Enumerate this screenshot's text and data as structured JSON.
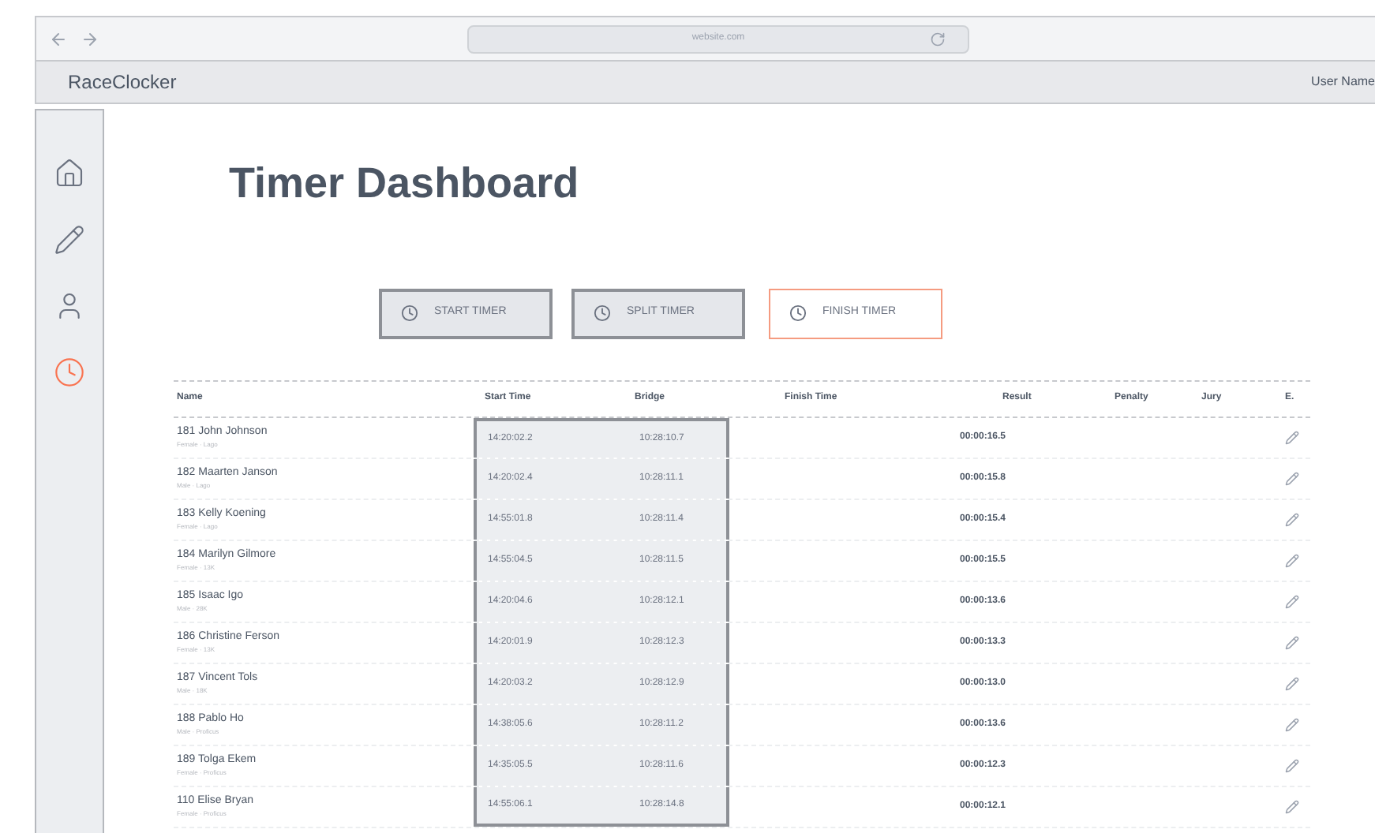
{
  "browser": {
    "url": "website.com"
  },
  "app": {
    "name": "RaceClocker",
    "user": "User Name"
  },
  "sidebar": {
    "items": [
      {
        "kind": "home",
        "selected": false
      },
      {
        "kind": "edit",
        "selected": false
      },
      {
        "kind": "user",
        "selected": false
      },
      {
        "kind": "clock",
        "selected": true
      }
    ]
  },
  "title": "Timer Dashboard",
  "buttons": [
    {
      "label": "START TIMER",
      "highlighted": false
    },
    {
      "label": "SPLIT TIMER",
      "highlighted": false
    },
    {
      "label": "FINISH TIMER",
      "highlighted": true
    }
  ],
  "table": {
    "columns": [
      "Name",
      "Start Time",
      "Bridge",
      "Finish Time",
      "Result",
      "Penalty",
      "Jury",
      "E."
    ],
    "rows": [
      {
        "name": "181 John Johnson",
        "category": "Female · Lago",
        "start": "14:20:02.2",
        "bridge": "10:28:10.7",
        "result": "00:00:16.5"
      },
      {
        "name": "182 Maarten Janson",
        "category": "Male · Lago",
        "start": "14:20:02.4",
        "bridge": "10:28:11.1",
        "result": "00:00:15.8"
      },
      {
        "name": "183 Kelly Koening",
        "category": "Female · Lago",
        "start": "14:55:01.8",
        "bridge": "10:28:11.4",
        "result": "00:00:15.4"
      },
      {
        "name": "184 Marilyn Gilmore",
        "category": "Female · 13K",
        "start": "14:55:04.5",
        "bridge": "10:28:11.5",
        "result": "00:00:15.5"
      },
      {
        "name": "185 Isaac Igo",
        "category": "Male · 28K",
        "start": "14:20:04.6",
        "bridge": "10:28:12.1",
        "result": "00:00:13.6"
      },
      {
        "name": "186 Christine Ferson",
        "category": "Female · 13K",
        "start": "14:20:01.9",
        "bridge": "10:28:12.3",
        "result": "00:00:13.3"
      },
      {
        "name": "187 Vincent Tols",
        "category": "Male · 18K",
        "start": "14:20:03.2",
        "bridge": "10:28:12.9",
        "result": "00:00:13.0"
      },
      {
        "name": "188 Pablo Ho",
        "category": "Male · Proficus",
        "start": "14:38:05.6",
        "bridge": "10:28:11.2",
        "result": "00:00:13.6"
      },
      {
        "name": "189 Tolga Ekem",
        "category": "Female · Proficus",
        "start": "14:35:05.5",
        "bridge": "10:28:11.6",
        "result": "00:00:12.3"
      },
      {
        "name": "110 Elise Bryan",
        "category": "Female · Proficus",
        "start": "14:55:06.1",
        "bridge": "10:28:14.8",
        "result": "00:00:12.1"
      }
    ]
  }
}
